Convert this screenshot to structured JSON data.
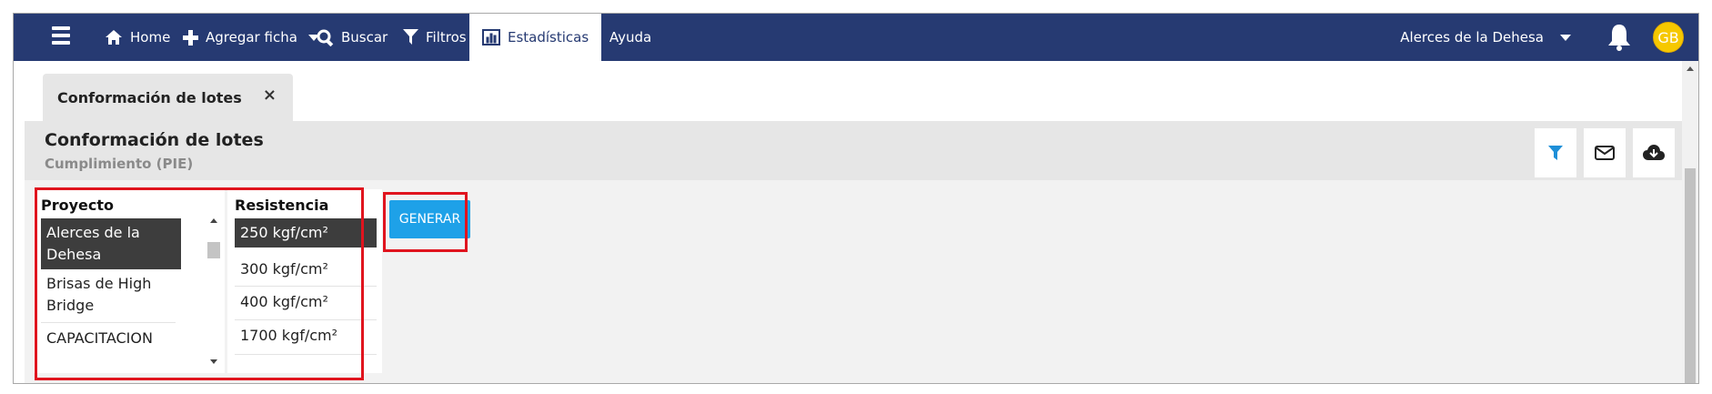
{
  "nav": {
    "items": [
      {
        "label": "Home",
        "icon": "home-icon"
      },
      {
        "label": "Agregar ficha",
        "icon": "plus-icon"
      },
      {
        "label": "Buscar",
        "icon": "search-icon"
      },
      {
        "label": "Filtros",
        "icon": "filter-icon"
      },
      {
        "label": "Estadísticas",
        "icon": "bar-chart-icon",
        "active": true
      },
      {
        "label": "Ayuda",
        "icon": "question-icon"
      }
    ],
    "project_selector": "Alerces de la Dehesa",
    "avatar_initials": "GB",
    "bar_color": "#263a72",
    "avatar_color": "#f6c800"
  },
  "tab": {
    "label": "Conformación de lotes",
    "close": "×"
  },
  "header": {
    "title": "Conformación de lotes",
    "subtitle": "Cumplimiento (PIE)",
    "actions": [
      "filter-icon",
      "mail-icon",
      "cloud-download-icon"
    ]
  },
  "filters": {
    "proyecto": {
      "heading": "Proyecto",
      "items": [
        "Alerces de la Dehesa",
        "Brisas de High Bridge",
        "CAPACITACION"
      ],
      "selected": "Alerces de la Dehesa"
    },
    "resistencia": {
      "heading": "Resistencia",
      "items": [
        "250 kgf/cm²",
        "300 kgf/cm²",
        "400 kgf/cm²",
        "1700 kgf/cm²"
      ],
      "selected": "250 kgf/cm²"
    }
  },
  "generate_button": "GENERAR",
  "highlight_color": "#e0141e",
  "button_color": "#1ea1e8"
}
